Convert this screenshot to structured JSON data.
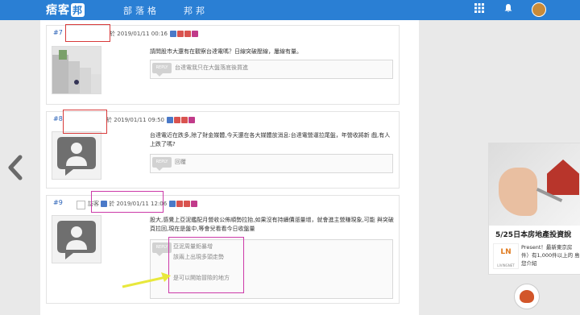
{
  "brand": {
    "logo_text": "痞客",
    "logo_badge": "邦"
  },
  "nav": {
    "items": [
      "部落格",
      "邦邦"
    ]
  },
  "topbar_icons": [
    "grid-icon",
    "bell-icon"
  ],
  "posts": [
    {
      "number": "#7",
      "date_prefix": "於",
      "datetime": "2019/01/11 00:16",
      "body": "請問股市大還有在觀察台達電嗎？日線突破壓線，屢線有量。",
      "reply_label": "REPLY",
      "reply_text": "台達電我只在大盤落底後買進"
    },
    {
      "number": "#8",
      "date_prefix": "於",
      "datetime": "2019/01/11 09:50",
      "body": "台達電近在跌多,除了財金媒體,今天還在各大媒體放消息:台達電營運拉尾盤，年營收將新 戲,有人上跌了嗎?",
      "reply_label": "REPLY",
      "reply_text": "回覆"
    },
    {
      "number": "#9",
      "author": "訪客",
      "date_prefix": "於",
      "datetime": "2019/01/11 12:06",
      "body": "股大,感覺上亞泥鑑配月營收公佈順勢拉抬,如果沒有持續價漲量增，就會進主營賺現象,可能 與突破頁拉回,現在是盤中,等會兒看看今日收盤量",
      "reply_label": "REPLY",
      "reply_lines": [
        "亞泥周量鉅暴增",
        "該兩上出現多頭走勢",
        "",
        "是可以開始冒險的地方"
      ]
    }
  ],
  "ad": {
    "title": "5/25日本房地產投資說",
    "logo_text": "LN",
    "logo_sub": "LIVINGNET",
    "description": "Present！最新東京房 件）有1,000件以上的 島您介紹"
  },
  "colors": {
    "topbar": "#2a7fd4",
    "highlight_red": "#d83a3a",
    "highlight_magenta": "#cc3aa8",
    "arrow": "#e8e83c"
  }
}
